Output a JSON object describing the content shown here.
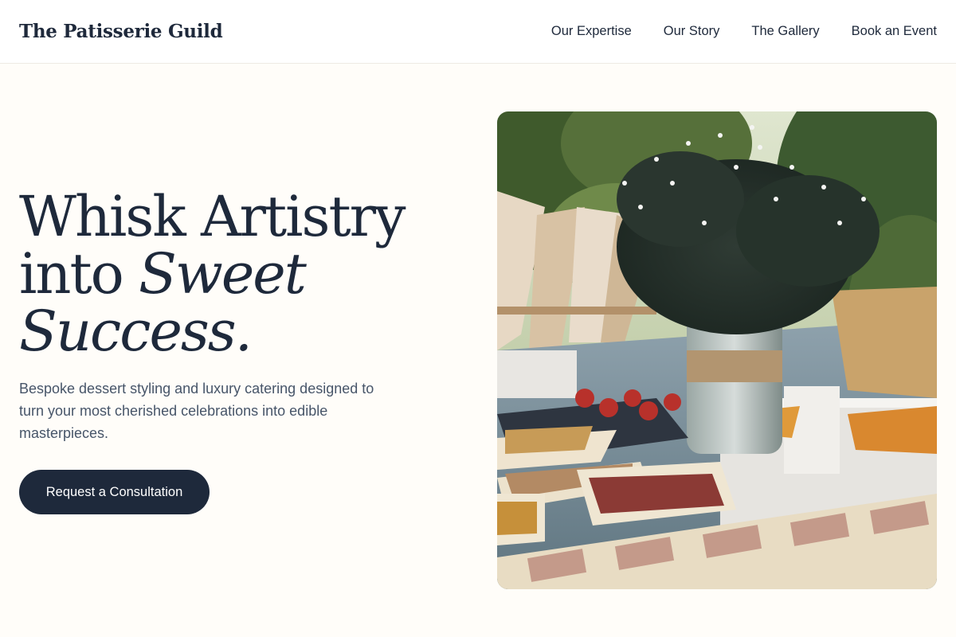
{
  "header": {
    "brand": "The Patisserie Guild",
    "nav": [
      "Our Expertise",
      "Our Story",
      "The Gallery",
      "Book an Event"
    ]
  },
  "hero": {
    "title_line1": "Whisk Artistry",
    "title_line2_plain": "into ",
    "title_line2_italic": "Sweet",
    "title_line3_italic": "Success.",
    "subtitle": "Bespoke dessert styling and luxury catering designed to turn your most cherished celebrations into edible masterpieces.",
    "cta_label": "Request a Consultation"
  },
  "colors": {
    "background": "#fffdf9",
    "ink": "#1e293b",
    "muted": "#475569",
    "button": "#1e293b"
  }
}
